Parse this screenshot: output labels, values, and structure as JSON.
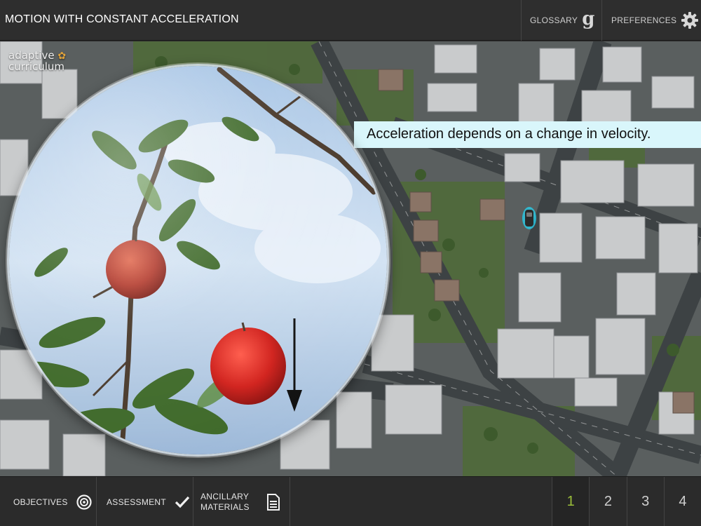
{
  "header": {
    "title": "MOTION WITH CONSTANT ACCELERATION",
    "glossary_label": "GLOSSARY",
    "glossary_icon_glyph": "g",
    "preferences_label": "PREFERENCES"
  },
  "scene": {
    "logo_line1": "adaptive",
    "logo_line2": "curriculum",
    "callout_text": "Acceleration depends on a change in velocity."
  },
  "footer": {
    "objectives_label": "OBJECTIVES",
    "assessment_label": "ASSESSMENT",
    "ancillary_line1": "ANCILLARY",
    "ancillary_line2": "MATERIALS",
    "pages": [
      "1",
      "2",
      "3",
      "4"
    ],
    "active_page": "1"
  },
  "colors": {
    "bar_bg": "#2e2e2e",
    "callout_bg": "#d9f6fb",
    "active_page": "#9bbf3a",
    "car_highlight": "#27d3f0"
  }
}
